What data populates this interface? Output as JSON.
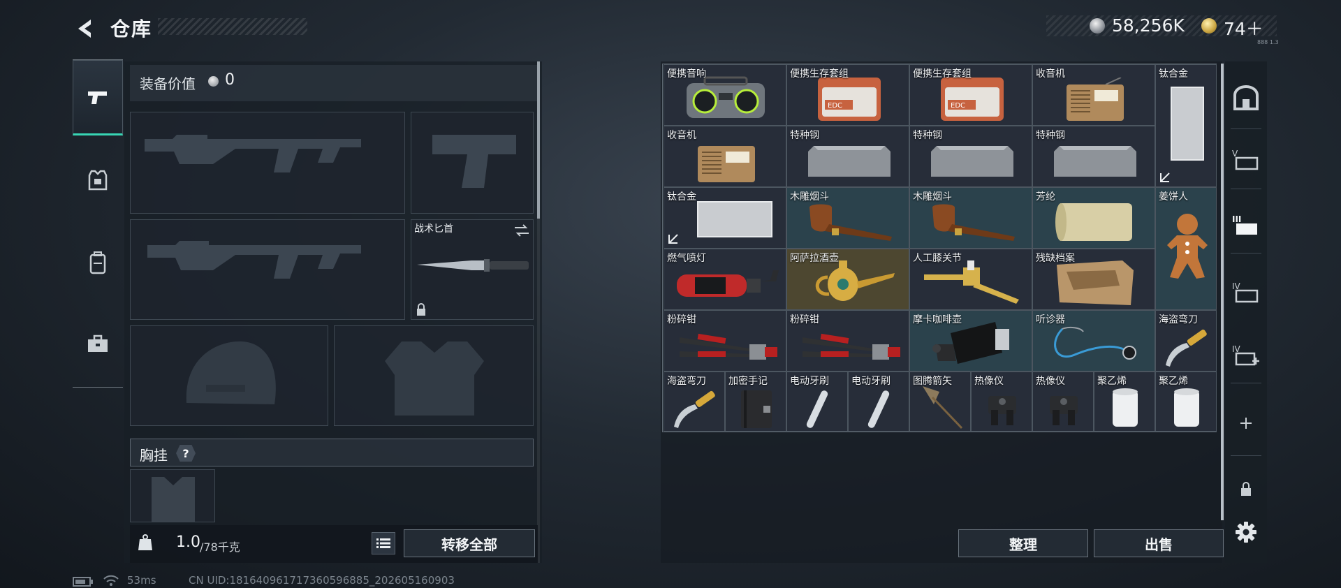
{
  "header": {
    "title": "仓库",
    "currencies": [
      {
        "name": "silver-coin",
        "value": "58,256K"
      },
      {
        "name": "gold-coin",
        "value": "74＋"
      }
    ],
    "version_label": "888 1.3"
  },
  "left_nav": [
    {
      "icon": "pistol-icon",
      "active": true
    },
    {
      "icon": "armor-icon",
      "active": false
    },
    {
      "icon": "backpack-icon",
      "active": false
    },
    {
      "icon": "toolbox-icon",
      "active": false
    }
  ],
  "equipment": {
    "value_label": "装备价值",
    "value": "0",
    "knife_slot_label": "战术匕首",
    "chest_rig_label": "胸挂",
    "help_label": "?",
    "weight": "1.0",
    "weight_capacity": "/78千克",
    "transfer_all_label": "转移全部"
  },
  "storage": {
    "items": [
      {
        "label": "便携音响",
        "icon": "boombox-icon"
      },
      {
        "label": "便携生存套组",
        "icon": "survival-kit-icon"
      },
      {
        "label": "便携生存套组",
        "icon": "survival-kit-icon"
      },
      {
        "label": "收音机",
        "icon": "radio-icon"
      },
      {
        "label": "钛合金",
        "icon": "titanium-plate-icon"
      },
      {
        "label": "收音机",
        "icon": "radio-icon"
      },
      {
        "label": "特种钢",
        "icon": "steel-ingot-icon"
      },
      {
        "label": "特种钢",
        "icon": "steel-ingot-icon"
      },
      {
        "label": "特种钢",
        "icon": "steel-ingot-icon"
      },
      {
        "label": "钛合金",
        "icon": "titanium-plate-icon"
      },
      {
        "label": "木雕烟斗",
        "icon": "pipe-icon"
      },
      {
        "label": "木雕烟斗",
        "icon": "pipe-icon"
      },
      {
        "label": "芳纶",
        "icon": "aramid-roll-icon"
      },
      {
        "label": "姜饼人",
        "icon": "gingerbread-icon"
      },
      {
        "label": "燃气喷灯",
        "icon": "gas-torch-icon"
      },
      {
        "label": "阿萨拉酒壶",
        "icon": "wine-ewer-icon"
      },
      {
        "label": "人工膝关节",
        "icon": "knee-joint-icon"
      },
      {
        "label": "残缺档案",
        "icon": "document-icon"
      },
      {
        "label": "粉碎钳",
        "icon": "bolt-cutter-icon"
      },
      {
        "label": "粉碎钳",
        "icon": "bolt-cutter-icon"
      },
      {
        "label": "摩卡咖啡壶",
        "icon": "moka-pot-icon"
      },
      {
        "label": "听诊器",
        "icon": "stethoscope-icon"
      },
      {
        "label": "海盗弯刀",
        "icon": "pirate-knife-icon"
      },
      {
        "label": "海盗弯刀",
        "icon": "pirate-knife-icon"
      },
      {
        "label": "加密手记",
        "icon": "notebook-icon"
      },
      {
        "label": "电动牙刷",
        "icon": "toothbrush-icon"
      },
      {
        "label": "电动牙刷",
        "icon": "toothbrush-icon"
      },
      {
        "label": "图腾箭矢",
        "icon": "arrow-icon"
      },
      {
        "label": "热像仪",
        "icon": "thermal-imager-icon"
      },
      {
        "label": "热像仪",
        "icon": "thermal-imager-icon"
      },
      {
        "label": "聚乙烯",
        "icon": "polyethylene-roll-icon"
      },
      {
        "label": "聚乙烯",
        "icon": "polyethylene-roll-icon"
      }
    ],
    "sort_label": "整理",
    "sell_label": "出售"
  },
  "right_rail": [
    {
      "icon": "storage-home-icon"
    },
    {
      "icon": "v-case-icon"
    },
    {
      "icon": "iii-case-icon"
    },
    {
      "icon": "iv-case-icon"
    },
    {
      "icon": "iv-medkit-icon"
    },
    {
      "icon": "add-icon"
    },
    {
      "icon": "lock-icon"
    },
    {
      "icon": "settings-gear-icon"
    }
  ],
  "status_bar": {
    "ping": "53ms",
    "uid": "CN UID:18164096171736059688​5_202605160903"
  }
}
